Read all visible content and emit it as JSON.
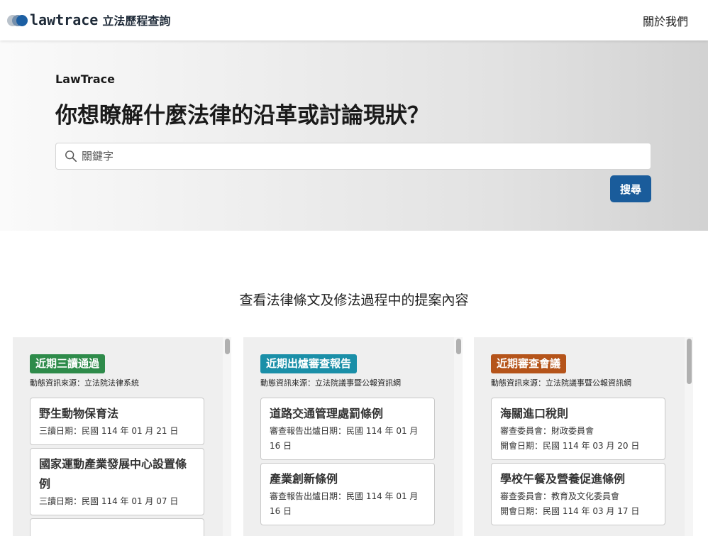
{
  "header": {
    "logo_word": "lawtrace",
    "logo_sub": "立法歷程查詢",
    "nav_about": "關於我們"
  },
  "hero": {
    "eyebrow": "LawTrace",
    "title": "你想瞭解什麼法律的沿革或討論現狀？",
    "search_placeholder": "關鍵字",
    "search_button": "搜尋"
  },
  "section_title": "查看法律條文及修法過程中的提案內容",
  "colors": {
    "badge_green": "#2e8b4a",
    "badge_teal": "#1a8fa8",
    "badge_orange": "#b5541a",
    "search_button": "#1a5c9b"
  },
  "panels": [
    {
      "badge": "近期三讀通過",
      "source": "動態資訊來源：立法院法律系統",
      "cards": [
        {
          "title": "野生動物保育法",
          "meta": [
            "三讀日期：民國 114 年 01 月 21 日"
          ]
        },
        {
          "title": "國家運動產業發展中心設置條例",
          "meta": [
            "三讀日期：民國 114 年 01 月 07 日"
          ]
        }
      ]
    },
    {
      "badge": "近期出爐審查報告",
      "source": "動態資訊來源：立法院議事暨公報資訊網",
      "cards": [
        {
          "title": "道路交通管理處罰條例",
          "meta": [
            "審查報告出爐日期：民國 114 年 01 月 16 日"
          ]
        },
        {
          "title": "產業創新條例",
          "meta": [
            "審查報告出爐日期：民國 114 年 01 月 16 日"
          ]
        }
      ]
    },
    {
      "badge": "近期審查會議",
      "source": "動態資訊來源：立法院議事暨公報資訊網",
      "cards": [
        {
          "title": "海關進口稅則",
          "meta": [
            "審查委員會：財政委員會",
            "開會日期：民國 114 年 03 月 20 日"
          ]
        },
        {
          "title": "學校午餐及營養促進條例",
          "meta": [
            "審查委員會：教育及文化委員會",
            "開會日期：民國 114 年 03 月 17 日"
          ]
        }
      ]
    }
  ]
}
